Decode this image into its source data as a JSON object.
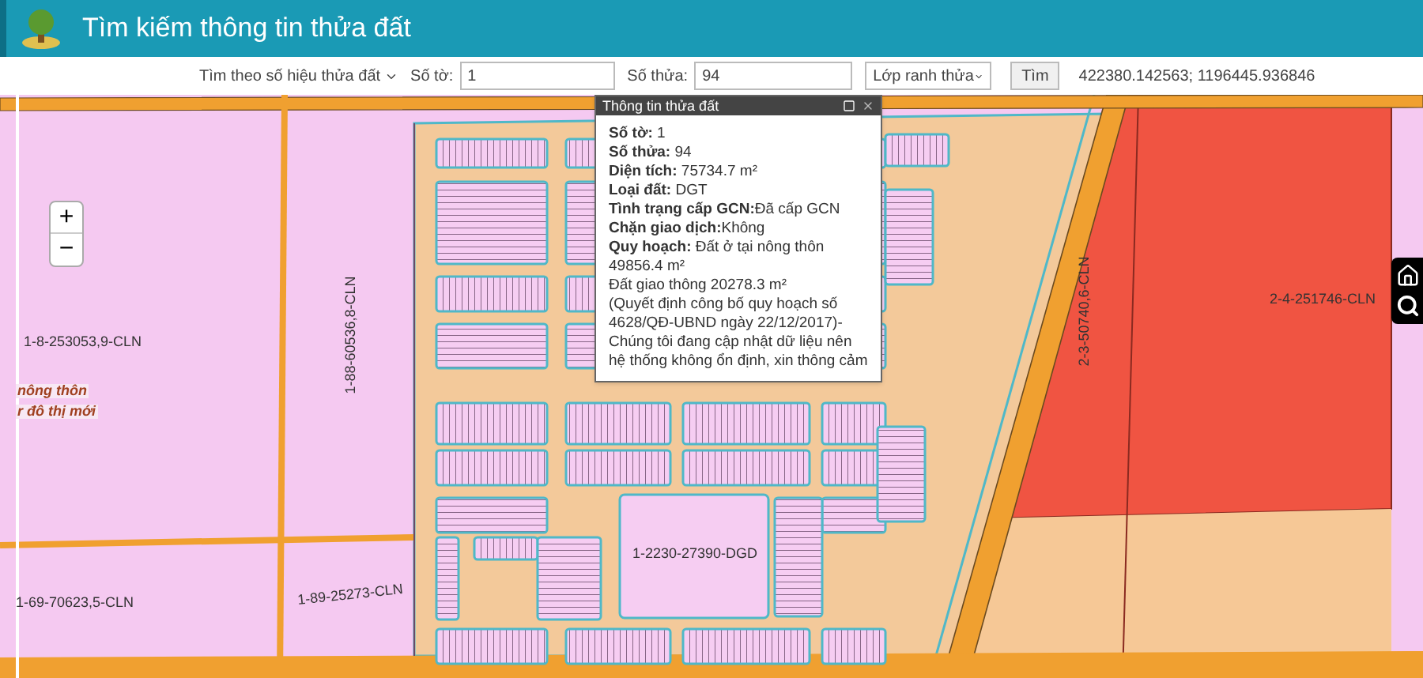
{
  "header": {
    "title": "Tìm kiếm thông tin thửa đất"
  },
  "toolbar": {
    "search_mode": "Tìm theo số hiệu thửa đất",
    "sheet_label": "Số tờ:",
    "sheet_value": "1",
    "parcel_label": "Số thửa:",
    "parcel_value": "94",
    "layer": "Lớp ranh thửa",
    "search_button": "Tìm",
    "coordinates": "422380.142563; 1196445.936846"
  },
  "map": {
    "zoom_in": "+",
    "zoom_out": "−",
    "labels": [
      {
        "text": "1-8-253053,9-CLN",
        "kind": "plain"
      },
      {
        "text": "nông thôn",
        "kind": "zone"
      },
      {
        "text": "r đô thị mới",
        "kind": "zone"
      },
      {
        "text": "1-88-60536,8-CLN",
        "kind": "vertical"
      },
      {
        "text": "1-69-70623,5-CLN",
        "kind": "plain"
      },
      {
        "text": "1-89-25273-CLN",
        "kind": "tilted"
      },
      {
        "text": "1-2230-27390-DGD",
        "kind": "plain"
      },
      {
        "text": "2-3-50740,6-CLN",
        "kind": "vertical"
      },
      {
        "text": "2-4-251746-CLN",
        "kind": "plain"
      }
    ]
  },
  "popup": {
    "title": "Thông tin thửa đất",
    "lines": [
      "**Số tờ:** 1",
      "**Số thửa:** 94",
      "**Diện tích:** 75734.7 m²",
      "**Loại đất:** DGT",
      "**Tình trạng cấp GCN:**Đã cấp GCN",
      "**Chặn giao dịch:**Không",
      "**Quy hoạch:** Đất ở tại nông thôn 49856.4 m²",
      "Đất giao thông 20278.3 m²",
      "(Quyết định công bố quy hoạch số 4628/QĐ-UBND ngày 22/12/2017)- Chúng tôi đang cập nhật dữ liệu nên hệ thống không ổn định, xin thông cảm"
    ]
  }
}
